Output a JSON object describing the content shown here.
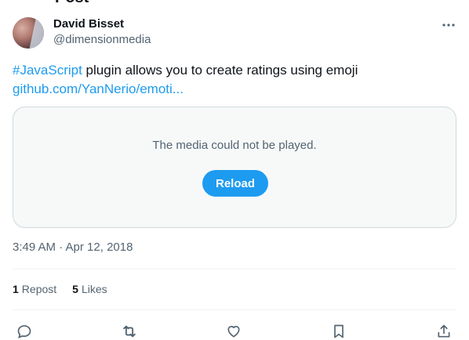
{
  "header": {
    "title_fragment": "Post"
  },
  "author": {
    "name": "David Bisset",
    "handle": "@dimensionmedia"
  },
  "tweet": {
    "hashtag": "#JavaScript",
    "text": " plugin allows you to create ratings using emoji",
    "link": "github.com/YanNerio/emoti..."
  },
  "media": {
    "error_message": "The media could not be played.",
    "reload_label": "Reload"
  },
  "timestamp": "3:49 AM · Apr 12, 2018",
  "stats": {
    "reposts_count": "1",
    "reposts_label": "Repost",
    "likes_count": "5",
    "likes_label": "Likes"
  },
  "icons": {
    "more": "more-horizontal-icon",
    "reply": "reply-icon",
    "repost": "repost-icon",
    "like": "heart-icon",
    "bookmark": "bookmark-icon",
    "share": "share-icon"
  },
  "colors": {
    "accent": "#1d9bf0",
    "secondary_text": "#536471",
    "border": "#cfd9de"
  }
}
